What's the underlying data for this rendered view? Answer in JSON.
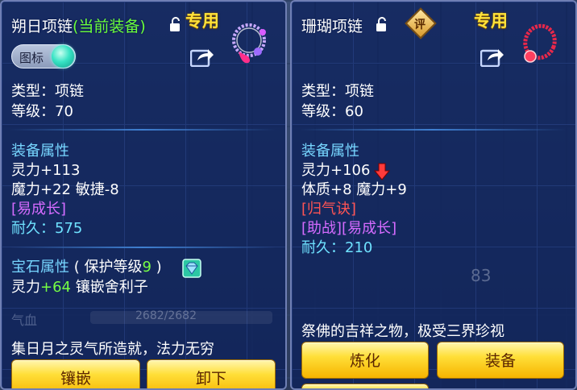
{
  "left": {
    "title": "朔日项链",
    "title_suffix": "(当前装备)",
    "tag": "专用",
    "toggle_label": "图标",
    "type_line": "类型：项链",
    "level_line": "等级：70",
    "attr_header": "装备属性",
    "attr_1": "灵力+113",
    "attr_2": "魔力+22 敏捷-8",
    "special": "[易成长]",
    "durability": "耐久：575",
    "gem_header": "宝石属性",
    "gem_protect_prefix": "( 保护等级",
    "gem_protect_level": "9",
    "gem_protect_suffix": ")",
    "gem_bonus_prefix": "灵力",
    "gem_bonus_value": "+64",
    "gem_bonus_suffix": " 镶嵌舍利子",
    "faded_hp_label": "气血",
    "faded_hp_value": "2682/2682",
    "description": "集日月之灵气所造就，法力无穷",
    "btn_1": "镶嵌",
    "btn_2": "卸下"
  },
  "right": {
    "title": "珊瑚项链",
    "rating": "评",
    "tag": "专用",
    "type_line": "类型：项链",
    "level_line": "等级：60",
    "attr_header": "装备属性",
    "attr_1": "灵力+106",
    "attr_2": "体质+8 魔力+9",
    "special_1": "[归气诀]",
    "special_2": "[助战][易成长]",
    "durability": "耐久：210",
    "description": "祭佛的吉祥之物，极受三界珍视",
    "btn_1": "炼化",
    "btn_2": "装备",
    "faded_count": "83"
  },
  "colors": {
    "panel_bg": "#0a1e5a",
    "title_paren": "#6cff3c",
    "section": "#77d6ff",
    "purple_special": "#d56bff",
    "red_special": "#ff5454",
    "durability": "#6fe2ff",
    "gem_level": "#76ff44",
    "button": "#ffdf38",
    "tag": "#ffe23a"
  },
  "icons": [
    "lock-open-icon",
    "share-icon",
    "necklace-icon",
    "gem-diamond-icon",
    "down-arrow-icon",
    "rating-badge-icon"
  ]
}
